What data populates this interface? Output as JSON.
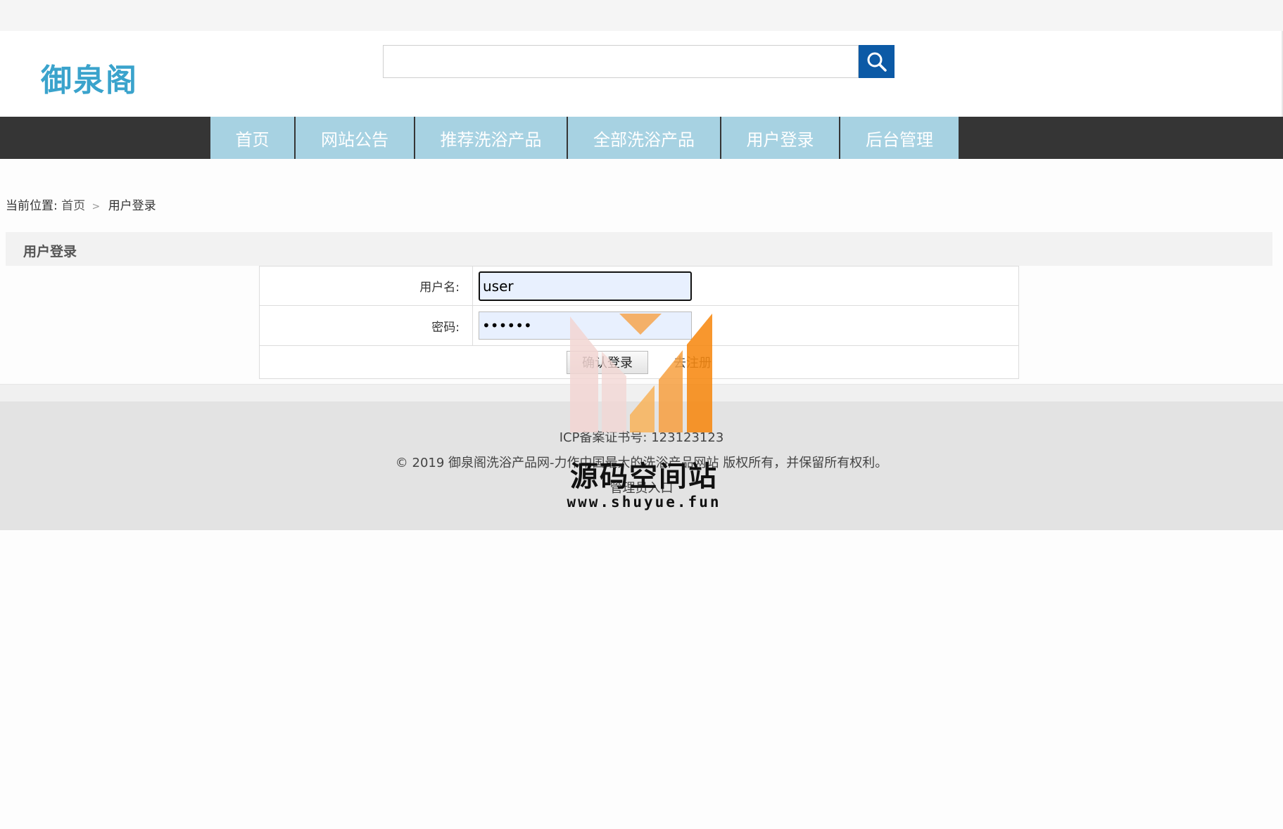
{
  "header": {
    "logo_text": "御泉阁",
    "search": {
      "value": "",
      "placeholder": ""
    },
    "search_button_icon": "search-icon"
  },
  "nav": {
    "items": [
      {
        "label": "首页"
      },
      {
        "label": "网站公告"
      },
      {
        "label": "推荐洗浴产品"
      },
      {
        "label": "全部洗浴产品"
      },
      {
        "label": "用户登录"
      },
      {
        "label": "后台管理"
      }
    ]
  },
  "breadcrumb": {
    "prefix": "当前位置:",
    "home": "首页",
    "separator": ">",
    "current": "用户登录"
  },
  "login": {
    "section_title": "用户登录",
    "username_label": "用户名:",
    "username_value": "user",
    "password_label": "密码:",
    "password_value": "••••••",
    "confirm_button": "确认登录",
    "register_link": "去注册"
  },
  "footer": {
    "icp": "ICP备案证书号: 123123123",
    "copyright": "© 2019 御泉阁洗浴产品网-力作中国最大的洗浴产品网站 版权所有，并保留所有权利。",
    "admin_entry": "管理员入口"
  },
  "watermark": {
    "text": "源码空间站",
    "url": "www.shuyue.fun"
  },
  "colors": {
    "nav_bar": "#353535",
    "nav_item": "#a7d2e2",
    "search_button": "#0c5aa6",
    "logo": "#3aa3cc",
    "footer": "#e3e3e3"
  }
}
